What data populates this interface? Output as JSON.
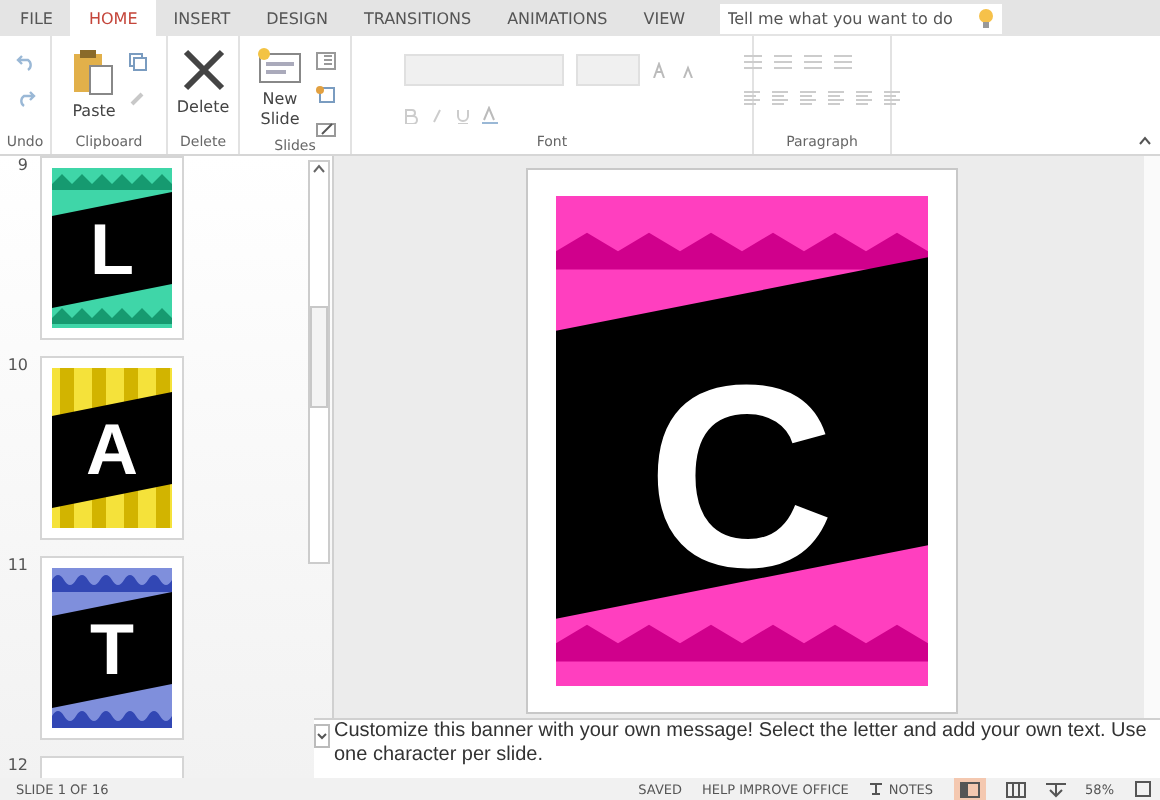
{
  "tabs": [
    {
      "label": "FILE",
      "selected": false
    },
    {
      "label": "HOME",
      "selected": true
    },
    {
      "label": "INSERT",
      "selected": false
    },
    {
      "label": "DESIGN",
      "selected": false
    },
    {
      "label": "TRANSITIONS",
      "selected": false
    },
    {
      "label": "ANIMATIONS",
      "selected": false
    },
    {
      "label": "VIEW",
      "selected": false
    }
  ],
  "search": {
    "placeholder": "Tell me what you want to do"
  },
  "ribbon": {
    "groups": [
      {
        "label": "Undo",
        "kind": "undo"
      },
      {
        "label": "Clipboard",
        "kind": "clipboard",
        "buttons": [
          "Paste"
        ]
      },
      {
        "label": "Delete",
        "kind": "delete",
        "buttons": [
          "Delete"
        ]
      },
      {
        "label": "Slides",
        "kind": "slides",
        "buttons": [
          "New Slide"
        ]
      },
      {
        "label": "Font",
        "kind": "font"
      },
      {
        "label": "Paragraph",
        "kind": "paragraph"
      }
    ]
  },
  "slides": [
    {
      "number": "9",
      "letter": "L",
      "kind": "zigzag",
      "color": "#3fd6a8"
    },
    {
      "number": "10",
      "letter": "A",
      "kind": "stripes",
      "color": "#f5e23a"
    },
    {
      "number": "11",
      "letter": "T",
      "kind": "waves",
      "color": "#7f8fdc"
    },
    {
      "number": "12"
    }
  ],
  "current_slide": {
    "letter": "C",
    "kind": "zigzag",
    "color": "#ff3fbf"
  },
  "notes": "Customize this banner with your own message! Select the letter and add your own text. Use one character per slide.",
  "status_bar": {
    "slide": "SLIDE 1 OF 16",
    "saved": "SAVED",
    "help": "HELP IMPROVE OFFICE",
    "notes": "NOTES",
    "zoom": "58%"
  }
}
